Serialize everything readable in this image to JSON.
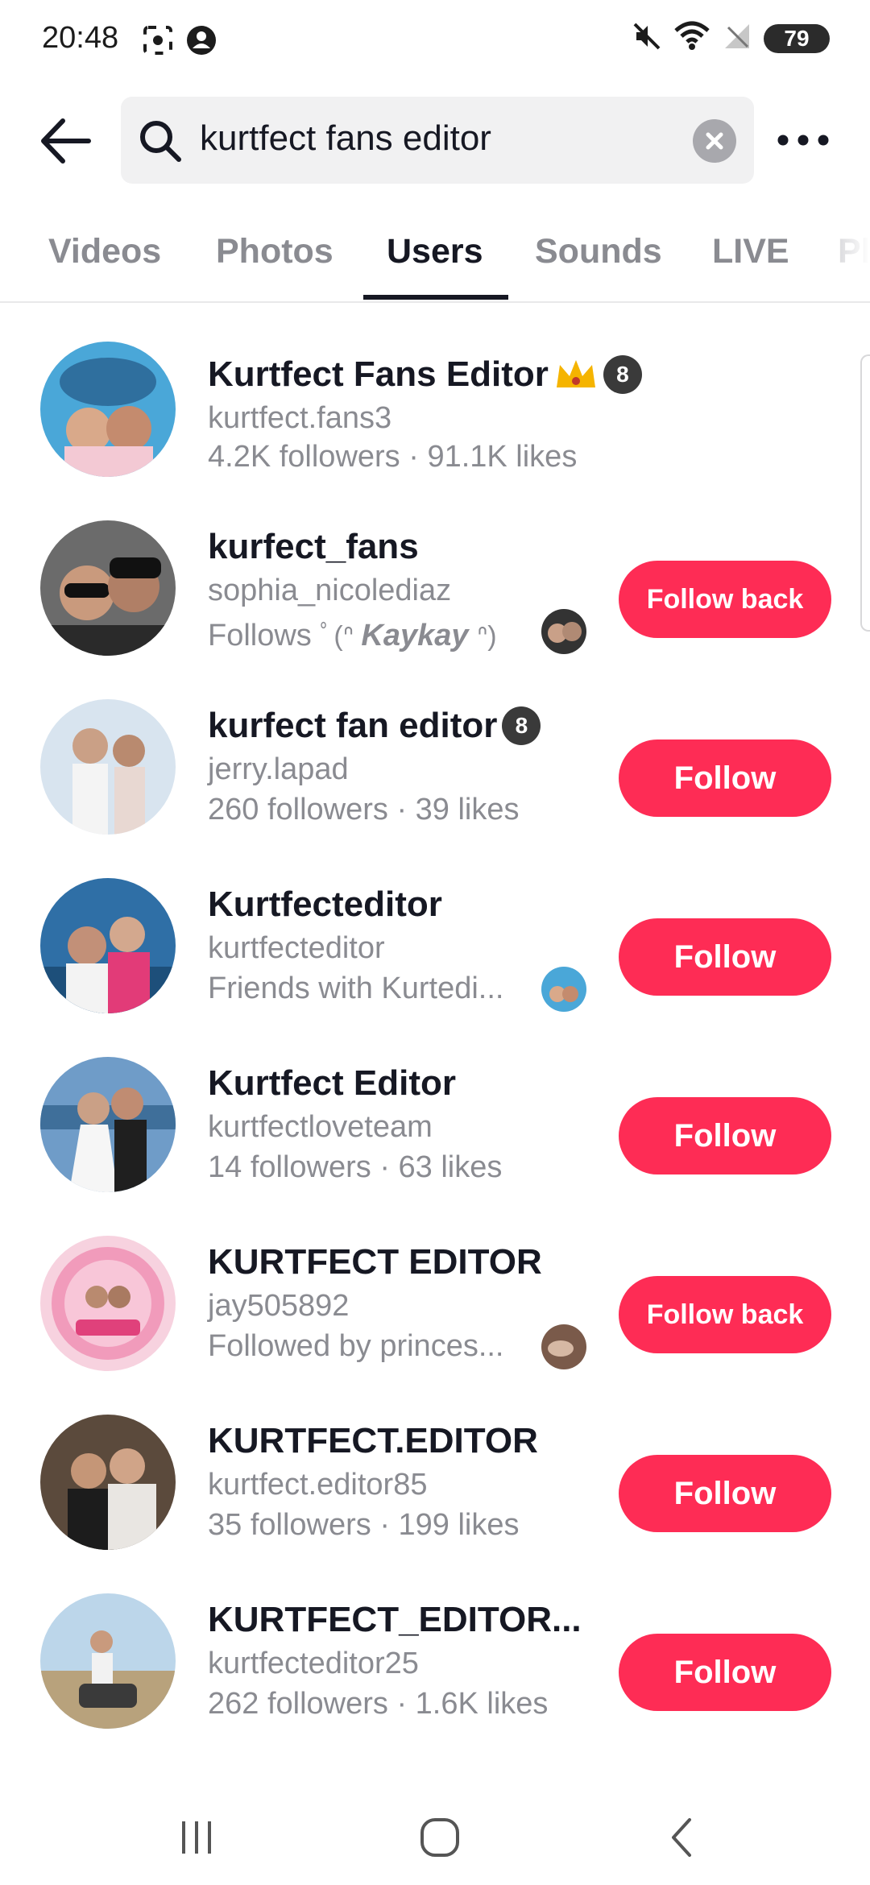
{
  "status": {
    "time": "20:48",
    "battery": "79",
    "icons": [
      "screenshot-icon",
      "account-icon",
      "mute-icon",
      "wifi-icon",
      "no-signal-icon",
      "battery-icon"
    ]
  },
  "search": {
    "query": "kurtfect fans editor",
    "icons": [
      "back-arrow-icon",
      "search-icon",
      "clear-icon",
      "more-icon"
    ]
  },
  "tabs": [
    "Videos",
    "Photos",
    "Users",
    "Sounds",
    "LIVE",
    "Pl"
  ],
  "active_tab": "Users",
  "users": [
    {
      "name": "Kurtfect Fans Editor",
      "handle": "kurtfect.fans3",
      "meta": "4.2K followers · 91.1K likes",
      "button": ""
    },
    {
      "name": "kurfect_fans",
      "handle": "sophia_nicolediaz",
      "meta_prefix": "Follows",
      "meta_name": "Kaykay",
      "button": "Follow back"
    },
    {
      "name": "kurfect fan editor",
      "handle": "jerry.lapad",
      "meta": "260 followers · 39 likes",
      "button": "Follow"
    },
    {
      "name": "Kurtfecteditor",
      "handle": "kurtfecteditor",
      "meta": "Friends with Kurtedi...",
      "button": "Follow"
    },
    {
      "name": "Kurtfect Editor",
      "handle": "kurtfectloveteam",
      "meta": "14 followers · 63 likes",
      "button": "Follow"
    },
    {
      "name": "KURTFECT EDITOR",
      "handle": "jay505892",
      "meta": "Followed by princes...",
      "button": "Follow back"
    },
    {
      "name": "KURTFECT.EDITOR",
      "handle": "kurtfect.editor85",
      "meta": "35 followers · 199 likes",
      "button": "Follow"
    },
    {
      "name": "KURTFECT_EDITOR...",
      "handle": "kurtfecteditor25",
      "meta": "262 followers · 1.6K likes",
      "button": "Follow"
    }
  ],
  "badge_text": "8",
  "colors": {
    "accent": "#fe2c55",
    "text_primary": "#161823",
    "text_secondary": "#8a8b91",
    "search_bg": "#f1f1f2"
  },
  "nav": {
    "icons": [
      "recent-apps-icon",
      "home-icon",
      "nav-back-icon"
    ]
  }
}
